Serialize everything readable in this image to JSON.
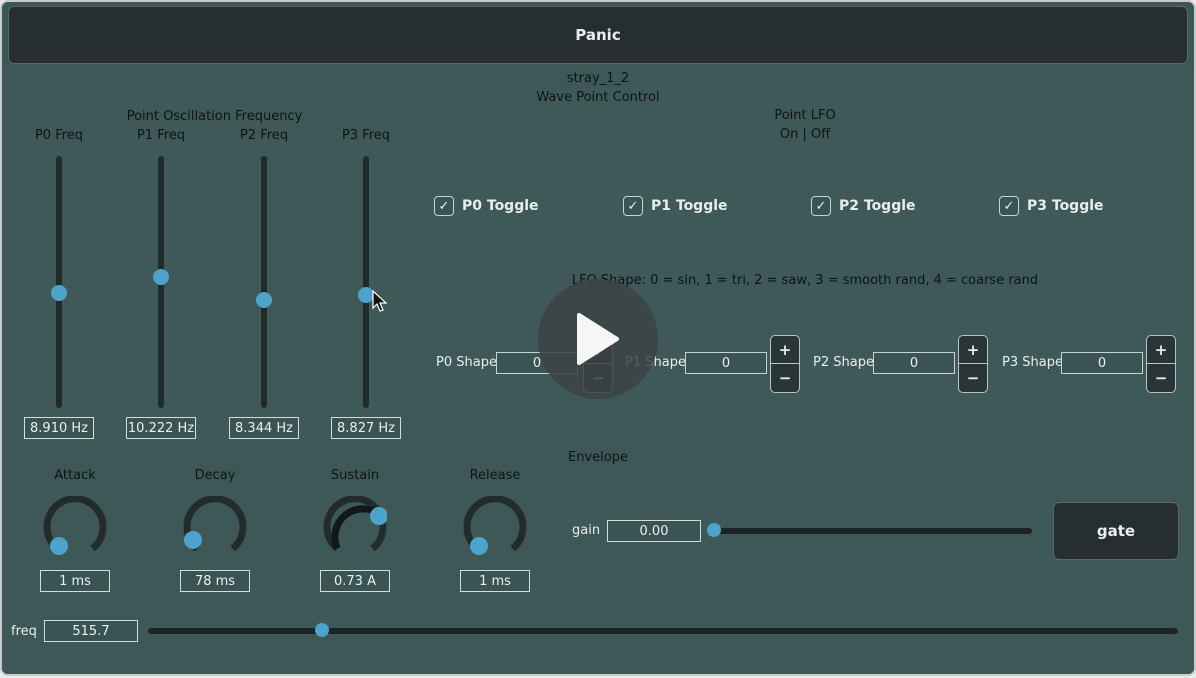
{
  "panic_label": "Panic",
  "patch_name": "stray_1_2",
  "wave_point_title": "Wave Point Control",
  "osc_title": "Point Oscillation Frequency",
  "freq_sliders": [
    {
      "label": "P0 Freq",
      "value": "8.910 Hz",
      "level": 0.45
    },
    {
      "label": "P1 Freq",
      "value": "10.222 Hz",
      "level": 0.52
    },
    {
      "label": "P2 Freq",
      "value": "8.344 Hz",
      "level": 0.42
    },
    {
      "label": "P3 Freq",
      "value": "8.827 Hz",
      "level": 0.45
    }
  ],
  "lfo": {
    "title": "Point LFO",
    "subtitle": "On | Off",
    "toggles": [
      {
        "label": "P0 Toggle",
        "checked": true
      },
      {
        "label": "P1 Toggle",
        "checked": true
      },
      {
        "label": "P2 Toggle",
        "checked": true
      },
      {
        "label": "P3 Toggle",
        "checked": true
      }
    ],
    "shape_help": "LFO Shape: 0 = sin, 1 = tri, 2 = saw, 3 = smooth rand, 4 = coarse rand",
    "shapes": [
      {
        "label": "P0 Shape",
        "value": "0"
      },
      {
        "label": "P1 Shape",
        "value": "0"
      },
      {
        "label": "P2 Shape",
        "value": "0"
      },
      {
        "label": "P3 Shape",
        "value": "0"
      }
    ],
    "plus": "+",
    "minus": "−"
  },
  "envelope": {
    "title": "Envelope",
    "knobs": [
      {
        "label": "Attack",
        "value": "1 ms",
        "level": 0.0
      },
      {
        "label": "Decay",
        "value": "78 ms",
        "level": 0.03
      },
      {
        "label": "Sustain",
        "value": "0.73 A",
        "level": 0.73
      },
      {
        "label": "Release",
        "value": "1 ms",
        "level": 0.0
      }
    ],
    "gain_label": "gain",
    "gain_value": "0.00",
    "gain_level": 0.0,
    "gate_label": "gate"
  },
  "freq": {
    "label": "freq",
    "value": "515.7",
    "level": 0.17
  },
  "colors": {
    "accent": "#4da3cb",
    "background": "#3e5858",
    "button": "#272e31"
  }
}
